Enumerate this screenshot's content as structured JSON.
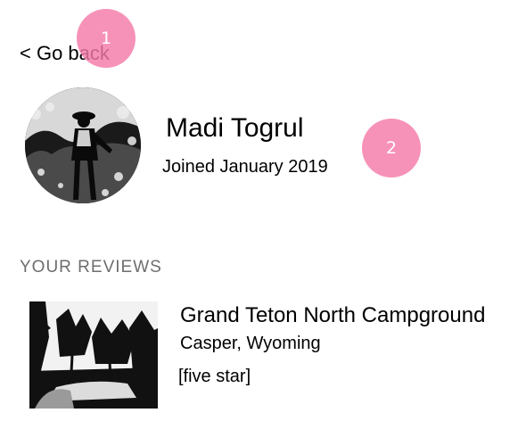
{
  "nav": {
    "go_back_label": "< Go back"
  },
  "profile": {
    "name": "Madi Togrul",
    "joined": "Joined January 2019"
  },
  "reviews_section": {
    "heading": "YOUR REVIEWS",
    "items": [
      {
        "title": "Grand Teton North Campground",
        "location": "Casper, Wyoming",
        "rating": "[five star]"
      }
    ]
  },
  "annotations": {
    "badge_1": "1",
    "badge_2": "2",
    "badge_color": "#f47aa8"
  }
}
